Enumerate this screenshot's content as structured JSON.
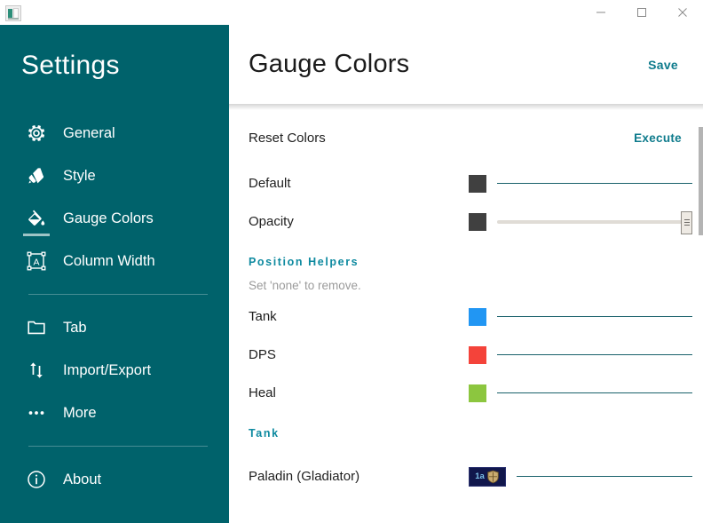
{
  "window": {
    "app_icon": "app-icon",
    "controls": [
      {
        "name": "minimize-button",
        "glyph": "minimize-icon"
      },
      {
        "name": "maximize-button",
        "glyph": "maximize-icon"
      },
      {
        "name": "close-button",
        "glyph": "close-icon"
      }
    ]
  },
  "sidebar": {
    "title": "Settings",
    "accent": "#00626b",
    "items": [
      {
        "label": "General",
        "icon": "gear-icon",
        "active": false
      },
      {
        "label": "Style",
        "icon": "palette-icon",
        "active": false
      },
      {
        "label": "Gauge Colors",
        "icon": "paint-bucket-icon",
        "active": true
      },
      {
        "label": "Column Width",
        "icon": "text-box-icon",
        "active": false
      },
      {
        "label": "Tab",
        "icon": "folder-icon",
        "active": false
      },
      {
        "label": "Import/Export",
        "icon": "arrows-updown-icon",
        "active": false
      },
      {
        "label": "More",
        "icon": "ellipsis-icon",
        "active": false
      },
      {
        "label": "About",
        "icon": "info-icon",
        "active": false
      }
    ]
  },
  "header": {
    "title": "Gauge Colors",
    "save_label": "Save",
    "link_color": "#0e7b8c"
  },
  "content": {
    "reset": {
      "label": "Reset Colors",
      "action_label": "Execute"
    },
    "rows": [
      {
        "label": "Default",
        "swatch": "#404040",
        "control": "color"
      },
      {
        "label": "Opacity",
        "swatch": "#404040",
        "control": "slider",
        "value": 100
      }
    ],
    "position_helpers": {
      "heading": "Position Helpers",
      "hint": "Set 'none' to remove.",
      "rows": [
        {
          "label": "Tank",
          "swatch": "#2196f3"
        },
        {
          "label": "DPS",
          "swatch": "#f4433a"
        },
        {
          "label": "Heal",
          "swatch": "#8cc63f"
        }
      ]
    },
    "tank_section": {
      "heading": "Tank",
      "rows": [
        {
          "label": "Paladin (Gladiator)",
          "chip_background": "#11174c",
          "chip_text": "1a",
          "chip_icon": "shield-icon"
        }
      ]
    }
  }
}
